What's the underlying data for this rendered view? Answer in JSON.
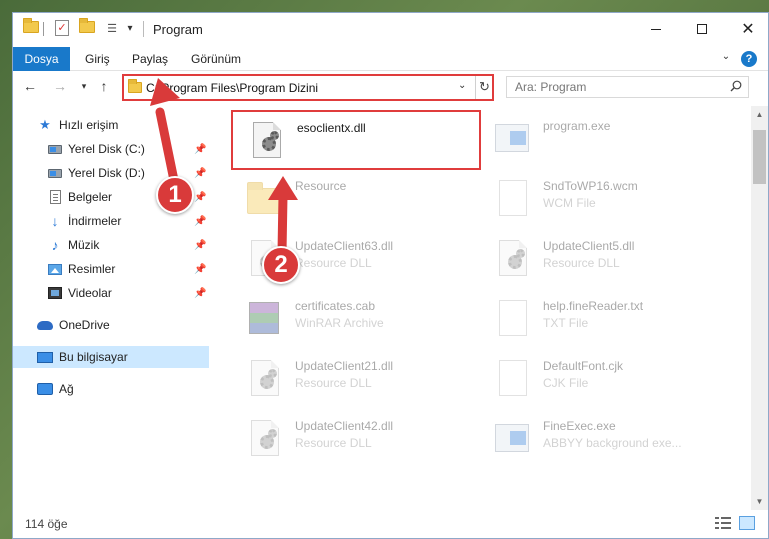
{
  "window": {
    "title": "Program",
    "controls": {
      "minimize": "minimize",
      "maximize": "maximize",
      "close": "✕"
    }
  },
  "ribbon": {
    "tabs": [
      {
        "label": "Dosya"
      },
      {
        "label": "Giriş"
      },
      {
        "label": "Paylaş"
      },
      {
        "label": "Görünüm"
      }
    ],
    "help": "?"
  },
  "address": {
    "path": "C:\\Program Files\\Program Dizini",
    "search_placeholder": "Ara: Program"
  },
  "sidebar": {
    "items": [
      {
        "label": "Hızlı erişim",
        "icon": "star-icon",
        "pinned": false
      },
      {
        "label": "Yerel Disk (C:)",
        "icon": "drive-icon",
        "pinned": true
      },
      {
        "label": "Yerel Disk (D:)",
        "icon": "drive-icon",
        "pinned": true
      },
      {
        "label": "Belgeler",
        "icon": "documents-icon",
        "pinned": true
      },
      {
        "label": "İndirmeler",
        "icon": "download-icon",
        "pinned": true
      },
      {
        "label": "Müzik",
        "icon": "music-icon",
        "pinned": true
      },
      {
        "label": "Resimler",
        "icon": "pictures-icon",
        "pinned": true
      },
      {
        "label": "Videolar",
        "icon": "video-icon",
        "pinned": true
      },
      {
        "label": "OneDrive",
        "icon": "cloud-icon",
        "pinned": false
      },
      {
        "label": "Bu bilgisayar",
        "icon": "computer-icon",
        "pinned": false,
        "selected": true
      },
      {
        "label": "Ağ",
        "icon": "network-icon",
        "pinned": false
      }
    ]
  },
  "files": [
    {
      "name": "esoclientx.dll",
      "type": "",
      "icon": "dll-file-icon",
      "highlighted": true
    },
    {
      "name": "program.exe",
      "type": "",
      "icon": "exe-file-icon"
    },
    {
      "name": "Resource",
      "type": "",
      "icon": "folder-icon"
    },
    {
      "name": "SndToWP16.wcm",
      "type": "WCM File",
      "icon": "blank-file-icon"
    },
    {
      "name": "UpdateClient63.dll",
      "type": "Resource DLL",
      "icon": "dll-file-icon"
    },
    {
      "name": "UpdateClient5.dll",
      "type": "Resource DLL",
      "icon": "dll-file-icon"
    },
    {
      "name": "certificates.cab",
      "type": "WinRAR Archive",
      "icon": "archive-icon"
    },
    {
      "name": "help.fineReader.txt",
      "type": "TXT File",
      "icon": "blank-file-icon"
    },
    {
      "name": "UpdateClient21.dll",
      "type": "Resource DLL",
      "icon": "dll-file-icon"
    },
    {
      "name": "DefaultFont.cjk",
      "type": "CJK File",
      "icon": "blank-file-icon"
    },
    {
      "name": "UpdateClient42.dll",
      "type": "Resource DLL",
      "icon": "dll-file-icon"
    },
    {
      "name": "FineExec.exe",
      "type": "ABBYY background exe...",
      "icon": "exe-file-icon"
    }
  ],
  "status": {
    "count": "114 öğe"
  },
  "annotations": [
    {
      "label": "1"
    },
    {
      "label": "2"
    }
  ],
  "colors": {
    "accent": "#1979ca",
    "highlight": "#e03c3c",
    "selected": "#cce8ff"
  }
}
